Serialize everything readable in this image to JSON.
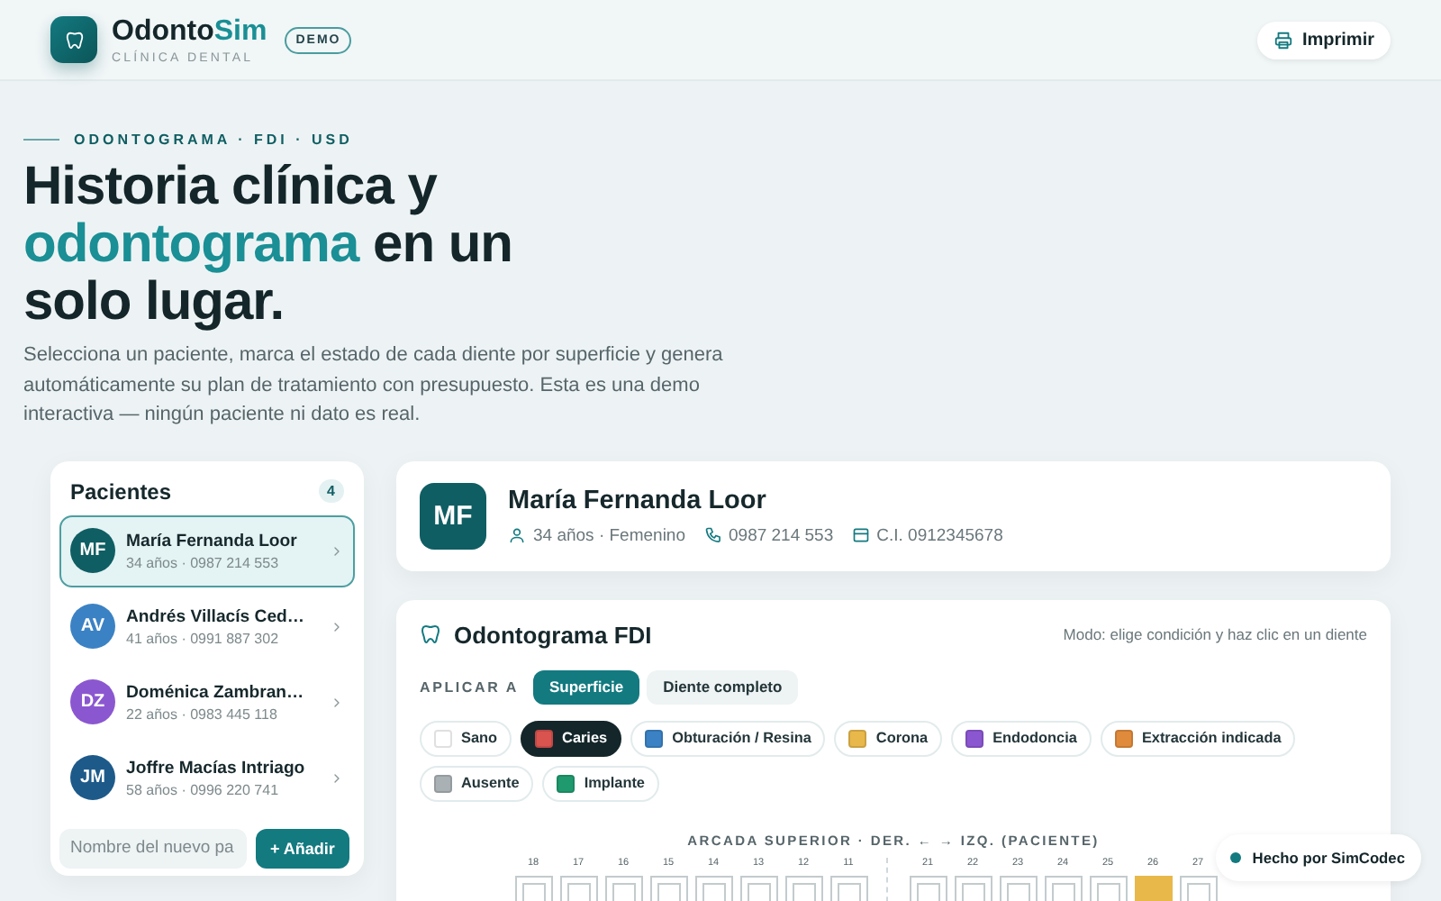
{
  "brand": {
    "name": "Odonto",
    "name_accent": "Sim",
    "subtitle": "CLÍNICA DENTAL",
    "badge": "DEMO"
  },
  "print_button": "Imprimir",
  "hero": {
    "eyebrow": "ODONTOGRAMA · FDI · USD",
    "title_start": "Historia clínica y ",
    "title_accent": "odontograma",
    "title_end": " en un solo lugar.",
    "description": "Selecciona un paciente, marca el estado de cada diente por superficie y genera automáticamente su plan de tratamiento con presupuesto. Esta es una demo interactiva — ningún paciente ni dato es real."
  },
  "patients": {
    "title": "Pacientes",
    "count": "4",
    "items": [
      {
        "initials": "MF",
        "color": "#0f5e63",
        "name": "María Fernanda Loor",
        "meta": "34 años · 0987 214 553",
        "selected": true
      },
      {
        "initials": "AV",
        "color": "#3b82c4",
        "name": "Andrés Villacís Ced…",
        "meta": "41 años · 0991 887 302",
        "selected": false
      },
      {
        "initials": "DZ",
        "color": "#8b57d0",
        "name": "Doménica Zambran…",
        "meta": "22 años · 0983 445 118",
        "selected": false
      },
      {
        "initials": "JM",
        "color": "#1d5a8a",
        "name": "Joffre Macías Intriago",
        "meta": "58 años · 0996 220 741",
        "selected": false
      }
    ],
    "new_placeholder": "Nombre del nuevo pa",
    "add_button": "+ Añadir"
  },
  "patient": {
    "initials": "MF",
    "name": "María Fernanda Loor",
    "age_sex": "34 años · Femenino",
    "phone": "0987 214 553",
    "id": "C.I. 0912345678"
  },
  "odontogram": {
    "title": "Odontograma FDI",
    "hint": "Modo: elige condición y haz clic en un diente",
    "apply_label": "APLICAR A",
    "apply_options": [
      {
        "label": "Superficie",
        "selected": true
      },
      {
        "label": "Diente completo",
        "selected": false
      }
    ],
    "conditions": [
      {
        "label": "Sano",
        "color": "#ffffff",
        "selected": false
      },
      {
        "label": "Caries",
        "color": "#d9534f",
        "selected": true
      },
      {
        "label": "Obturación / Resina",
        "color": "#3b82c4",
        "selected": false
      },
      {
        "label": "Corona",
        "color": "#e8b84a",
        "selected": false
      },
      {
        "label": "Endodoncia",
        "color": "#8b57d0",
        "selected": false
      },
      {
        "label": "Extracción indicada",
        "color": "#e08a3c",
        "selected": false
      },
      {
        "label": "Ausente",
        "color": "#a9b1b5",
        "selected": false
      },
      {
        "label": "Implante",
        "color": "#1f9a6e",
        "selected": false
      }
    ],
    "arch_title": "ARCADA SUPERIOR · DER. ← → IZQ. (PACIENTE)",
    "right_quadrant": [
      {
        "label": "18"
      },
      {
        "label": "17"
      },
      {
        "label": "16"
      },
      {
        "label": "15"
      },
      {
        "label": "14"
      },
      {
        "label": "13"
      },
      {
        "label": "12"
      },
      {
        "label": "11"
      }
    ],
    "left_quadrant": [
      {
        "label": "21"
      },
      {
        "label": "22"
      },
      {
        "label": "23"
      },
      {
        "label": "24"
      },
      {
        "label": "25"
      },
      {
        "label": "26",
        "color": "#e8b84a"
      },
      {
        "label": "27"
      }
    ]
  },
  "credit": "Hecho por SimCodec"
}
